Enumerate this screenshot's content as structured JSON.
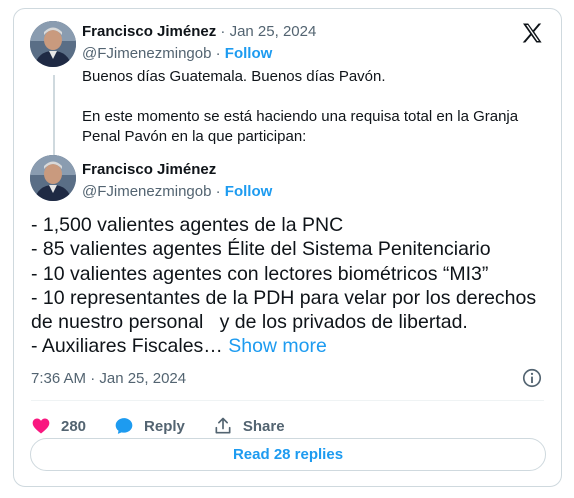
{
  "quoted": {
    "author_name": "Francisco Jiménez",
    "date": "· Jan 25, 2024",
    "handle": "@FJimenezmingob",
    "separator": "·",
    "follow_label": "Follow",
    "text": "Buenos días Guatemala. Buenos días Pavón.\n\nEn este momento se está haciendo una requisa total en la Granja Penal Pavón en la que participan:"
  },
  "post": {
    "author_name": "Francisco Jiménez",
    "handle": "@FJimenezmingob",
    "separator": "·",
    "follow_label": "Follow",
    "lines": [
      "- 1,500 valientes agentes de la PNC",
      "- 85 valientes agentes Élite del Sistema Penitenciario",
      "- 10 valientes agentes con lectores biométricos “MI3”",
      "- 10 representantes de la PDH para velar por los derechos",
      "de nuestro personal   y de los privados de libertad."
    ],
    "last_line_text": "- Auxiliares Fiscales…",
    "show_more_label": "Show more",
    "timestamp": "7:36 AM · Jan 25, 2024"
  },
  "actions": {
    "likes_count": "280",
    "reply_label": "Reply",
    "share_label": "Share",
    "read_replies_label": "Read 28 replies"
  },
  "icons": {
    "brand": "x-logo-icon",
    "like": "heart-icon",
    "reply": "speech-bubble-icon",
    "share": "share-icon",
    "info": "info-icon"
  },
  "colors": {
    "accent": "#1d9bf0",
    "like": "#f91880",
    "muted": "#536471",
    "text": "#0f1419",
    "border": "#cfd9de"
  }
}
